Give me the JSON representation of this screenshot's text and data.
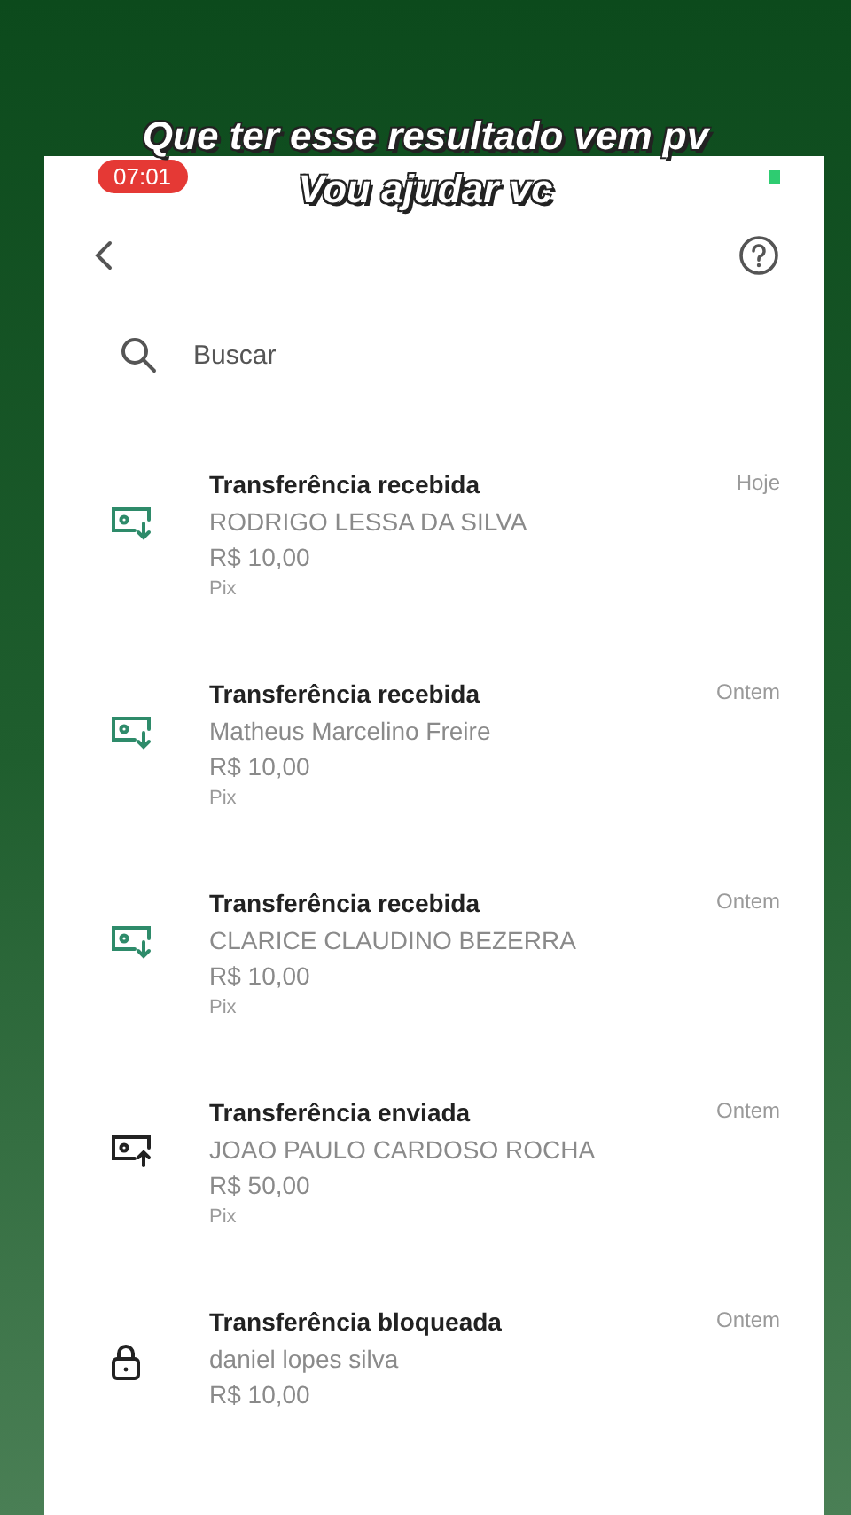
{
  "caption": [
    "Que ter esse resultado vem pv",
    "Vou ajudar vc"
  ],
  "status_bar": {
    "timer": "07:01"
  },
  "search": {
    "placeholder": "Buscar"
  },
  "transactions": [
    {
      "kind": "received",
      "title": "Transferência recebida",
      "name": "RODRIGO LESSA DA SILVA",
      "amount": "R$ 10,00",
      "method": "Pix",
      "date": "Hoje"
    },
    {
      "kind": "received",
      "title": "Transferência recebida",
      "name": "Matheus Marcelino Freire",
      "amount": "R$ 10,00",
      "method": "Pix",
      "date": "Ontem"
    },
    {
      "kind": "received",
      "title": "Transferência recebida",
      "name": "CLARICE CLAUDINO BEZERRA",
      "amount": "R$ 10,00",
      "method": "Pix",
      "date": "Ontem"
    },
    {
      "kind": "sent",
      "title": "Transferência enviada",
      "name": "JOAO PAULO CARDOSO ROCHA",
      "amount": "R$ 50,00",
      "method": "Pix",
      "date": "Ontem"
    },
    {
      "kind": "blocked",
      "title": "Transferência bloqueada",
      "name": "daniel lopes silva",
      "amount": "R$ 10,00",
      "date": "Ontem"
    }
  ]
}
